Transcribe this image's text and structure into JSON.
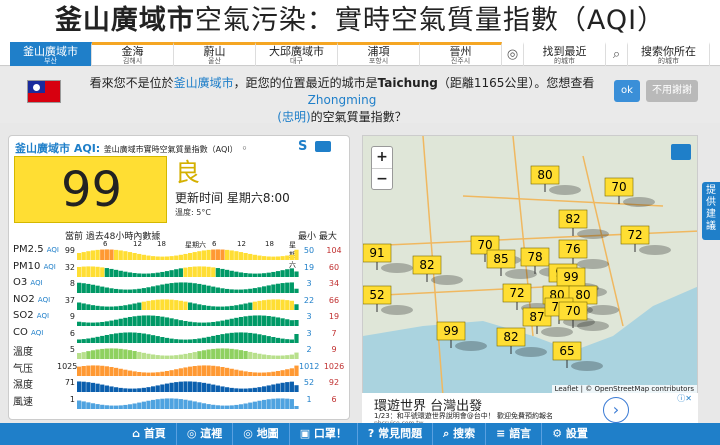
{
  "header": {
    "city": "釜山廣域市",
    "rest": "空氣污染：實時空氣質量指數（AQI）"
  },
  "cities": [
    {
      "name": "釜山廣域市",
      "sub": "부산",
      "active": true
    },
    {
      "name": "金海",
      "sub": "김해시",
      "active": false
    },
    {
      "name": "蔚山",
      "sub": "울산",
      "active": false
    },
    {
      "name": "大邱廣域市",
      "sub": "대구",
      "active": false
    },
    {
      "name": "浦項",
      "sub": "포항시",
      "active": false
    },
    {
      "name": "晉州",
      "sub": "진주시",
      "active": false
    }
  ],
  "nearest": {
    "label": "找到最近",
    "sub": "的城市"
  },
  "search": {
    "label": "搜索你所在",
    "sub": "的城市"
  },
  "notice": {
    "p1": "看來您不是位於",
    "city": "釜山廣域市",
    "p2": "，距您的位置最近的城市是",
    "near_city": "Taichung",
    "p3": "（距離1165公里）。您想查看",
    "suggest1": "Zhongming",
    "suggest2": "(忠明)",
    "p4": "的空氣質量指數？",
    "ok": "ok",
    "no": "不用謝謝"
  },
  "panel": {
    "city": "釜山廣域市 AQI:",
    "subtitle": "釜山廣域市實時空氣質量指數（AQI）",
    "aqi": "99",
    "level": "良",
    "updated": "更新时间 星期六8:00",
    "temp": "溫度: 5°C",
    "history_label": "當前 過去48小時內數據",
    "minmax": "最小 最大",
    "ticks": [
      "6",
      "12",
      "18",
      "星期六",
      "6",
      "12",
      "18",
      "星期六"
    ]
  },
  "rows": [
    {
      "label": "PM2.5",
      "unit": "AQI",
      "value": "99",
      "min": "50",
      "max": "104",
      "type": "aqi"
    },
    {
      "label": "PM10",
      "unit": "AQI",
      "value": "32",
      "min": "19",
      "max": "60",
      "type": "aqi"
    },
    {
      "label": "O3",
      "unit": "AQI",
      "value": "8",
      "min": "3",
      "max": "34",
      "type": "aqi"
    },
    {
      "label": "NO2",
      "unit": "AQI",
      "value": "37",
      "min": "22",
      "max": "66",
      "type": "aqi"
    },
    {
      "label": "SO2",
      "unit": "AQI",
      "value": "9",
      "min": "3",
      "max": "19",
      "type": "aqi"
    },
    {
      "label": "CO",
      "unit": "AQI",
      "value": "6",
      "min": "3",
      "max": "7",
      "type": "aqi"
    },
    {
      "label": "溫度",
      "unit": "",
      "value": "5",
      "min": "2",
      "max": "9",
      "type": "temp"
    },
    {
      "label": "气压",
      "unit": "",
      "value": "1025",
      "min": "1012",
      "max": "1026",
      "type": "pressure"
    },
    {
      "label": "濕度",
      "unit": "",
      "value": "71",
      "min": "52",
      "max": "92",
      "type": "humidity"
    },
    {
      "label": "風速",
      "unit": "",
      "value": "1",
      "min": "1",
      "max": "6",
      "type": "wind"
    }
  ],
  "map": {
    "markers": [
      "91",
      "52",
      "70",
      "80",
      "70",
      "82",
      "72",
      "82",
      "85",
      "78",
      "76",
      "99",
      "99",
      "72",
      "80",
      "80",
      "87",
      "70",
      "70",
      "99",
      "82",
      "65"
    ],
    "attribution": "Leaflet | © OpenStreetMap contributors"
  },
  "ad": {
    "title": "環遊世界 台灣出發",
    "text": "1/23：和平號環遊世界說明會@台中！ 歡迎免費預約報名",
    "url": "pbcruise.com.tw"
  },
  "feedback": "提供建議",
  "bottom": [
    "首頁",
    "這裡",
    "地圖",
    "口罩！",
    "常見問題",
    "搜索",
    "語言",
    "設置"
  ],
  "colors": {
    "accent": "#1f7fc9",
    "good": "#009966",
    "moderate": "#ffde33",
    "unhealthy": "#cc0033"
  }
}
